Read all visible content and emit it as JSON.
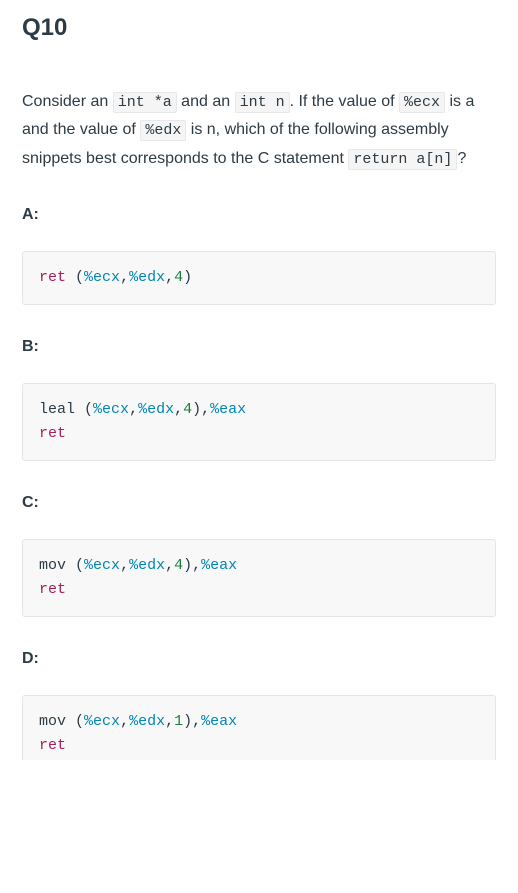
{
  "qnum": "Q10",
  "question": {
    "t1": "Consider an ",
    "c1": "int *a",
    "t2": " and an ",
    "c2": "int n",
    "t3": ". If the value of ",
    "c3": "%ecx",
    "t4": " is a and the value of ",
    "c4": "%edx",
    "t5": " is n, which of the following assembly snippets best corresponds to the C statement ",
    "c5": "return a[n]",
    "t6": "?"
  },
  "options": {
    "a": {
      "label": "A:",
      "code": {
        "kw1": "ret",
        "sp1": " ",
        "p1": "(",
        "r1": "%ecx",
        "c1": ",",
        "r2": "%edx",
        "c2": ",",
        "n1": "4",
        "p2": ")"
      }
    },
    "b": {
      "label": "B:",
      "code": {
        "ins1": "leal",
        "sp1": " ",
        "p1": "(",
        "r1": "%ecx",
        "c1": ",",
        "r2": "%edx",
        "c2": ",",
        "n1": "4",
        "p2": ")",
        "c3": ",",
        "r3": "%eax",
        "kw2": "ret"
      }
    },
    "c": {
      "label": "C:",
      "code": {
        "ins1": "mov",
        "sp1": " ",
        "p1": "(",
        "r1": "%ecx",
        "c1": ",",
        "r2": "%edx",
        "c2": ",",
        "n1": "4",
        "p2": ")",
        "c3": ",",
        "r3": "%eax",
        "kw2": "ret"
      }
    },
    "d": {
      "label": "D:",
      "code": {
        "ins1": "mov",
        "sp1": " ",
        "p1": "(",
        "r1": "%ecx",
        "c1": ",",
        "r2": "%edx",
        "c2": ",",
        "n1": "1",
        "p2": ")",
        "c3": ",",
        "r3": "%eax",
        "kw2": "ret"
      }
    }
  }
}
